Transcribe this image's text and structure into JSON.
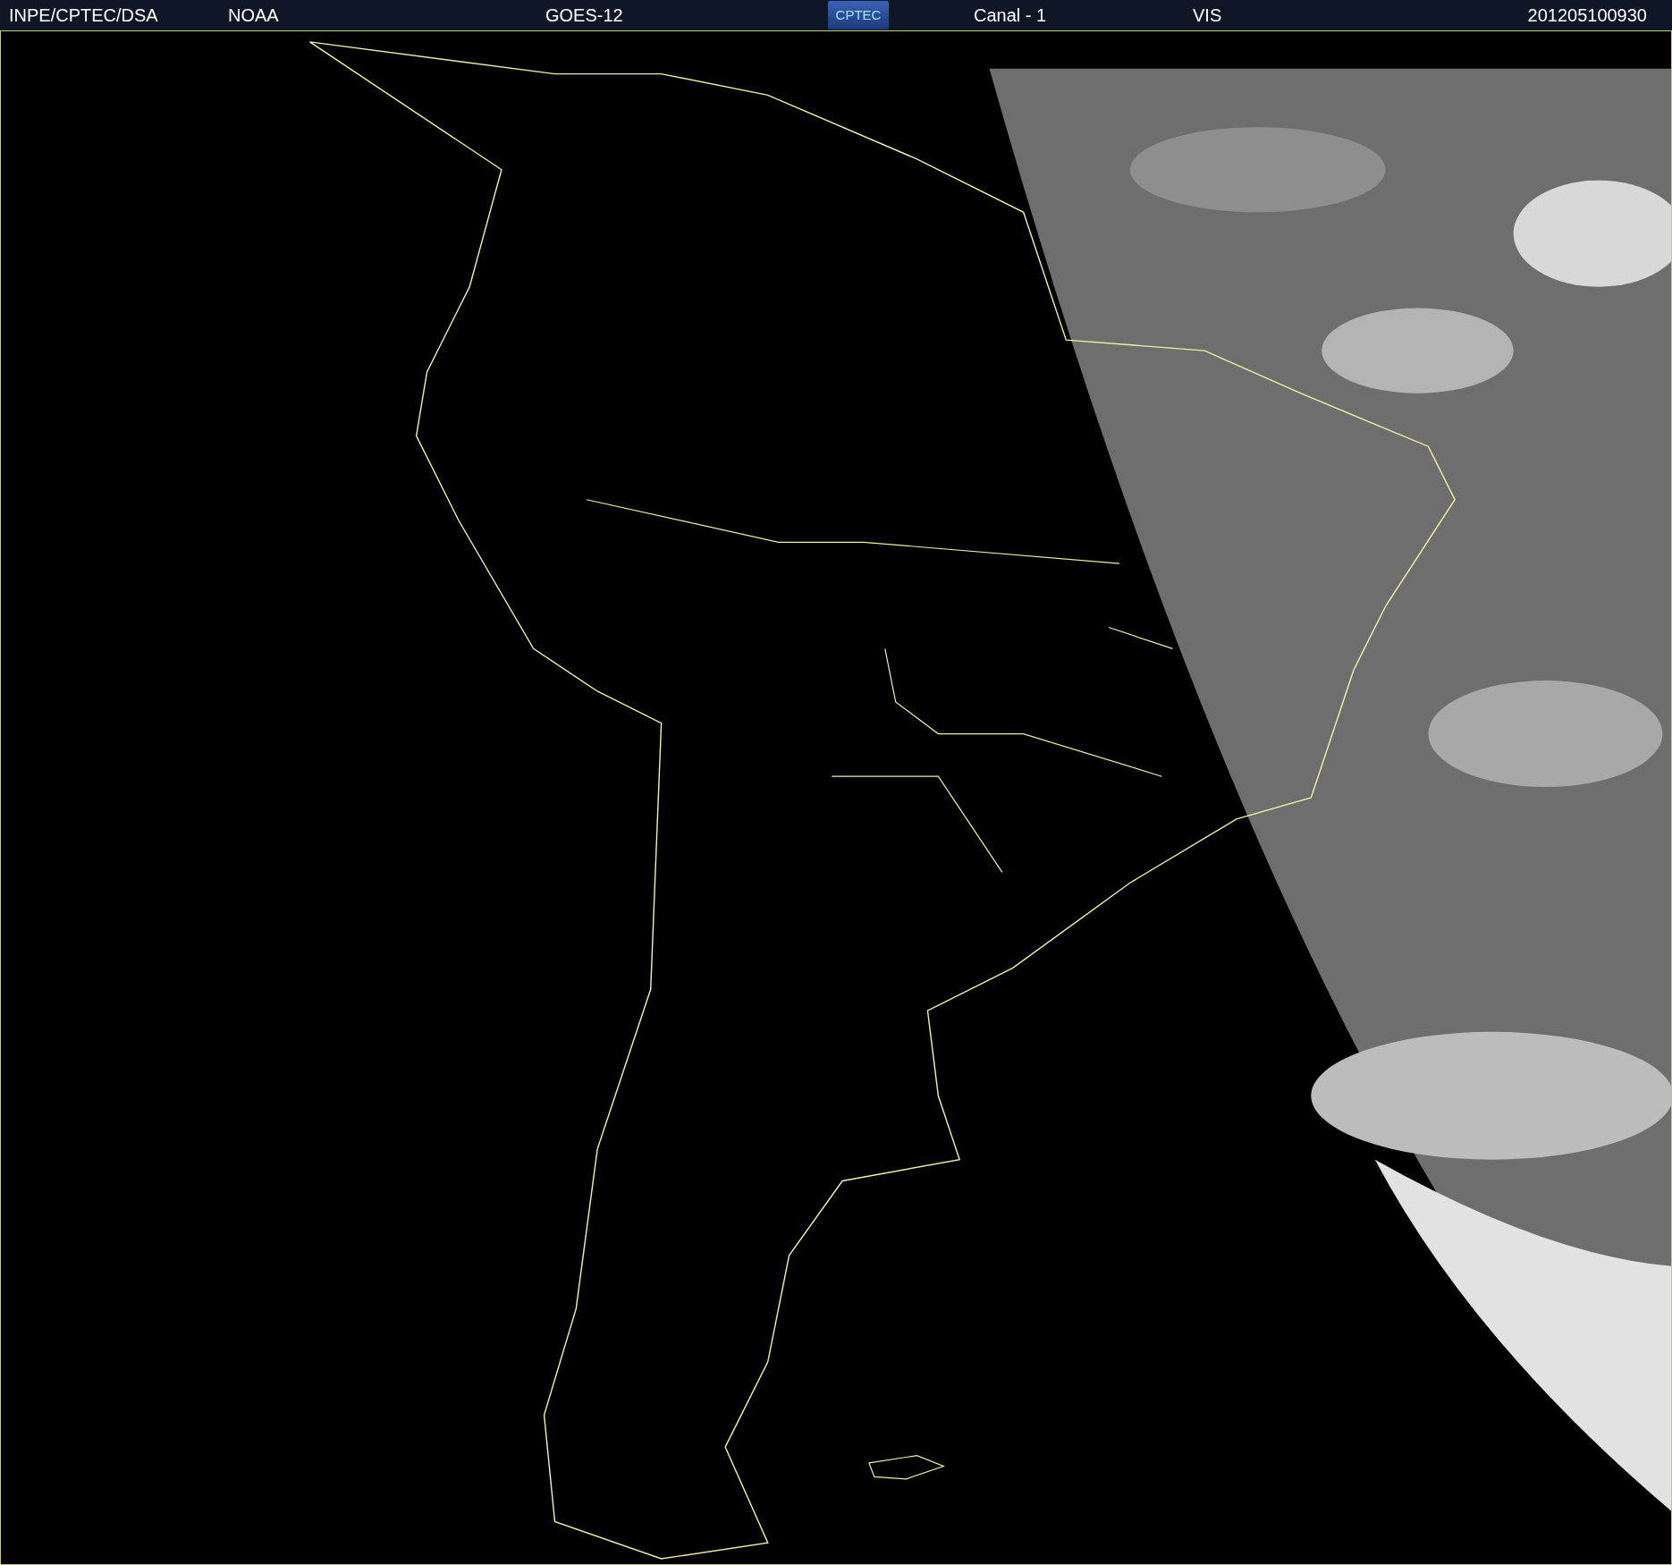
{
  "header": {
    "fields": [
      {
        "text": "INPE/CPTEC/DSA"
      },
      {
        "text": "NOAA"
      },
      {
        "text": "GOES-12"
      },
      {
        "kind": "logo",
        "text": "CPTEC"
      },
      {
        "text": "Canal - 1"
      },
      {
        "text": "VIS"
      },
      {
        "text": "201205100930"
      }
    ]
  }
}
